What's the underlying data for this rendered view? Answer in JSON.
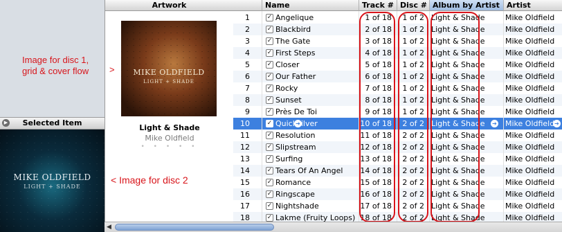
{
  "annotations": {
    "disc1_line1": "Image for disc 1,",
    "disc1_line2": "grid & cover flow",
    "disc1_arrow": ">",
    "disc2": "<  Image for disc 2"
  },
  "sidebar": {
    "selected_item_label": "Selected Item",
    "cover_title": "MIKE OLDFIELD",
    "cover_subtitle": "LIGHT + SHADE"
  },
  "artwork": {
    "header": "Artwork",
    "cover_title": "MIKE OLDFIELD",
    "cover_subtitle": "LIGHT + SHADE",
    "album_title": "Light & Shade",
    "album_artist": "Mike Oldfield",
    "dots": "• • • • •"
  },
  "columns": {
    "name": "Name",
    "track": "Track #",
    "disc": "Disc #",
    "album": "Album by Artist",
    "artist": "Artist"
  },
  "check_glyph": "✓",
  "rows": [
    {
      "num": "1",
      "name": "Angelique",
      "track": "1 of 18",
      "disc": "1 of 2",
      "album": "Light & Shade",
      "artist": "Mike Oldfield"
    },
    {
      "num": "2",
      "name": "Blackbird",
      "track": "2 of 18",
      "disc": "1 of 2",
      "album": "Light & Shade",
      "artist": "Mike Oldfield"
    },
    {
      "num": "3",
      "name": "The Gate",
      "track": "3 of 18",
      "disc": "1 of 2",
      "album": "Light & Shade",
      "artist": "Mike Oldfield"
    },
    {
      "num": "4",
      "name": "First Steps",
      "track": "4 of 18",
      "disc": "1 of 2",
      "album": "Light & Shade",
      "artist": "Mike Oldfield"
    },
    {
      "num": "5",
      "name": "Closer",
      "track": "5 of 18",
      "disc": "1 of 2",
      "album": "Light & Shade",
      "artist": "Mike Oldfield"
    },
    {
      "num": "6",
      "name": "Our Father",
      "track": "6 of 18",
      "disc": "1 of 2",
      "album": "Light & Shade",
      "artist": "Mike Oldfield"
    },
    {
      "num": "7",
      "name": "Rocky",
      "track": "7 of 18",
      "disc": "1 of 2",
      "album": "Light & Shade",
      "artist": "Mike Oldfield"
    },
    {
      "num": "8",
      "name": "Sunset",
      "track": "8 of 18",
      "disc": "1 of 2",
      "album": "Light & Shade",
      "artist": "Mike Oldfield"
    },
    {
      "num": "9",
      "name": "Près De Toi",
      "track": "9 of 18",
      "disc": "1 of 2",
      "album": "Light & Shade",
      "artist": "Mike Oldfield"
    },
    {
      "num": "10",
      "name": "Quicksilver",
      "track": "10 of 18",
      "disc": "2 of 2",
      "album": "Light & Shade",
      "artist": "Mike Oldfield",
      "selected": true
    },
    {
      "num": "11",
      "name": "Resolution",
      "track": "11 of 18",
      "disc": "2 of 2",
      "album": "Light & Shade",
      "artist": "Mike Oldfield"
    },
    {
      "num": "12",
      "name": "Slipstream",
      "track": "12 of 18",
      "disc": "2 of 2",
      "album": "Light & Shade",
      "artist": "Mike Oldfield"
    },
    {
      "num": "13",
      "name": "Surfing",
      "track": "13 of 18",
      "disc": "2 of 2",
      "album": "Light & Shade",
      "artist": "Mike Oldfield"
    },
    {
      "num": "14",
      "name": "Tears Of An Angel",
      "track": "14 of 18",
      "disc": "2 of 2",
      "album": "Light & Shade",
      "artist": "Mike Oldfield"
    },
    {
      "num": "15",
      "name": "Romance",
      "track": "15 of 18",
      "disc": "2 of 2",
      "album": "Light & Shade",
      "artist": "Mike Oldfield"
    },
    {
      "num": "16",
      "name": "Ringscape",
      "track": "16 of 18",
      "disc": "2 of 2",
      "album": "Light & Shade",
      "artist": "Mike Oldfield"
    },
    {
      "num": "17",
      "name": "Nightshade",
      "track": "17 of 18",
      "disc": "2 of 2",
      "album": "Light & Shade",
      "artist": "Mike Oldfield"
    },
    {
      "num": "18",
      "name": "Lakme (Fruity Loops)",
      "track": "18 of 18",
      "disc": "2 of 2",
      "album": "Light & Shade",
      "artist": "Mike Oldfield"
    }
  ],
  "colors": {
    "selection": "#3d80df",
    "annotation": "#d8141a"
  }
}
